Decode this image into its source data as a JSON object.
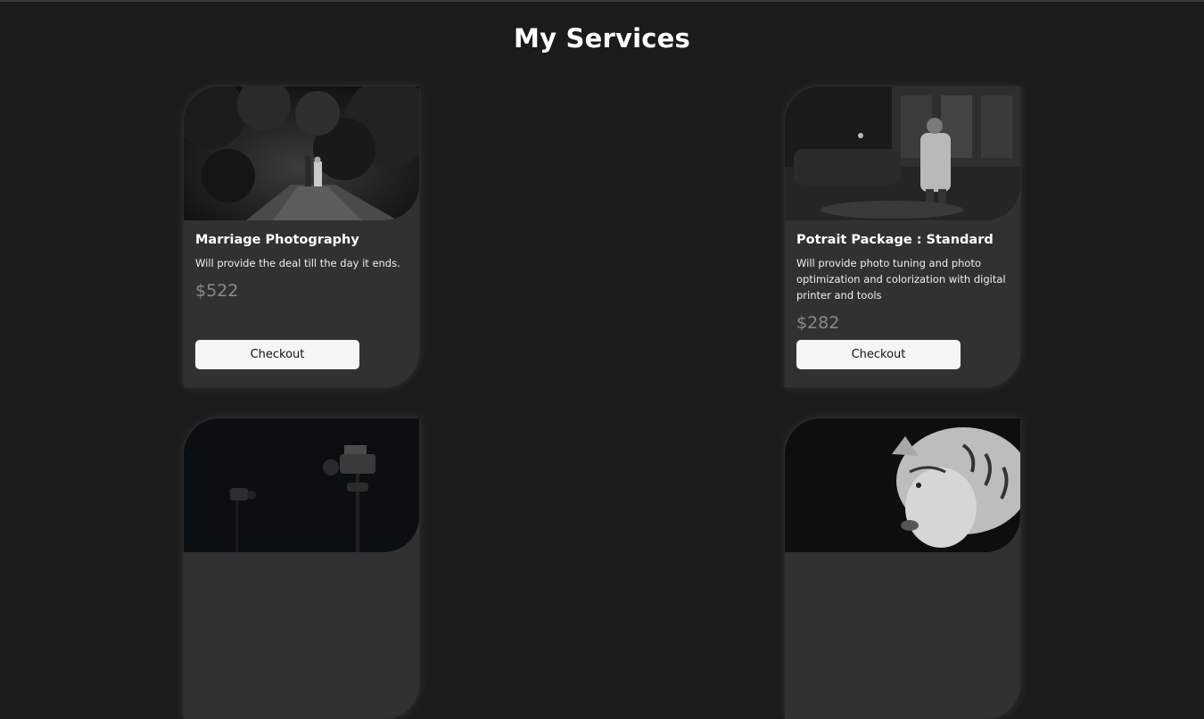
{
  "page": {
    "title": "My Services"
  },
  "services": [
    {
      "title": "Marriage Photography",
      "description": "Will provide the deal till the day it ends.",
      "price": "$522",
      "button": "Checkout",
      "image": "couple-walking-forest-photo"
    },
    {
      "title": "Potrait Package : Standard",
      "description": "Will provide photo tuning and photo optimization and colorization with digital printer and tools",
      "price": "$282",
      "button": "Checkout",
      "image": "man-portrait-workshop-photo"
    },
    {
      "title": "",
      "description": "",
      "price": "",
      "button": "",
      "image": "cameras-dark-photo"
    },
    {
      "title": "",
      "description": "",
      "price": "",
      "button": "",
      "image": "white-tiger-photo"
    }
  ],
  "colors": {
    "background": "#1b1b1b",
    "card": "#313131",
    "price": "#8a8a8a",
    "button": "#f5f5f5"
  }
}
